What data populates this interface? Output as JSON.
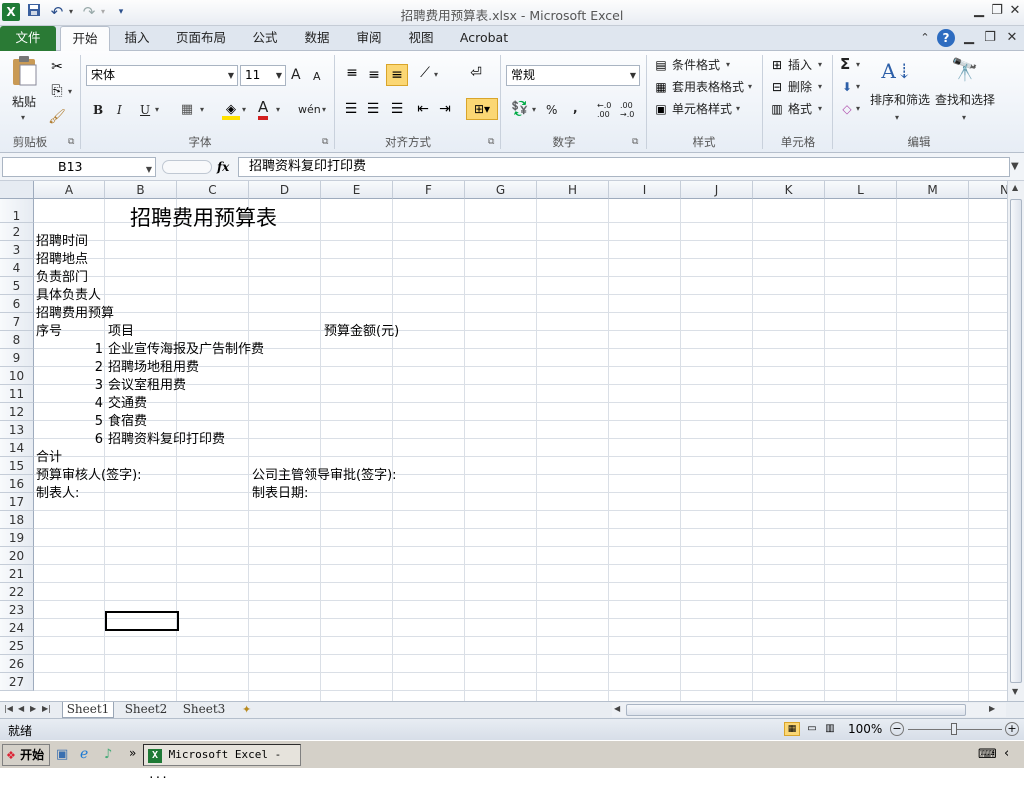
{
  "window": {
    "title": "招聘费用预算表.xlsx - Microsoft Excel"
  },
  "qat": {
    "undo": "↶",
    "redo": "↷"
  },
  "tabs": [
    "文件",
    "开始",
    "插入",
    "页面布局",
    "公式",
    "数据",
    "审阅",
    "视图",
    "Acrobat"
  ],
  "ribbon": {
    "clipboard": {
      "paste": "粘贴",
      "label": "剪贴板"
    },
    "font": {
      "name": "宋体",
      "size": "11",
      "bold": "B",
      "italic": "I",
      "underline": "U",
      "label": "字体",
      "grow": "A",
      "shrink": "A",
      "color_a": "A",
      "phonetic": "wén"
    },
    "align": {
      "label": "对齐方式"
    },
    "number": {
      "format": "常规",
      "percent": "%",
      "comma": ",",
      "inc": "←.0 .00",
      "dec": ".00 →.0",
      "label": "数字"
    },
    "styles": {
      "cond": "条件格式",
      "table": "套用表格格式",
      "cell": "单元格样式",
      "label": "样式"
    },
    "cells": {
      "insert": "插入",
      "delete": "删除",
      "format": "格式",
      "label": "单元格"
    },
    "editing": {
      "sort": "排序和筛选",
      "find": "查找和选择",
      "label": "编辑",
      "sigma": "Σ"
    }
  },
  "formula_bar": {
    "name_box": "B13",
    "fx": "fx",
    "content": "招聘资料复印打印费"
  },
  "columns": [
    "A",
    "B",
    "C",
    "D",
    "E",
    "F",
    "G",
    "H",
    "I",
    "J",
    "K",
    "L",
    "M",
    "N"
  ],
  "rows": [
    "1",
    "2",
    "3",
    "4",
    "5",
    "6",
    "7",
    "8",
    "9",
    "10",
    "11",
    "12",
    "13",
    "14",
    "15",
    "16",
    "17",
    "18",
    "19",
    "20",
    "21",
    "22",
    "23",
    "24",
    "25",
    "26",
    "27"
  ],
  "cells": {
    "title": "招聘费用预算表",
    "a2": "招聘时间",
    "a3": "招聘地点",
    "a4": "负责部门",
    "a5": "具体负责人",
    "a6": "招聘费用预算",
    "a7": "序号",
    "b7": "项目",
    "e7": "预算金额(元)",
    "items": [
      {
        "no": "1",
        "name": "企业宣传海报及广告制作费"
      },
      {
        "no": "2",
        "name": "招聘场地租用费"
      },
      {
        "no": "3",
        "name": "会议室租用费"
      },
      {
        "no": "4",
        "name": "交通费"
      },
      {
        "no": "5",
        "name": "食宿费"
      },
      {
        "no": "6",
        "name": "招聘资料复印打印费"
      }
    ],
    "a14": "合计",
    "a15": "预算审核人(签字):",
    "d15": "公司主管领导审批(签字):",
    "a16": "制表人:",
    "d16": "制表日期:"
  },
  "sheets": [
    "Sheet1",
    "Sheet2",
    "Sheet3"
  ],
  "status": {
    "ready": "就绪",
    "zoom": "100%"
  },
  "taskbar": {
    "start": "开始",
    "app": "Microsoft Excel - ..."
  }
}
